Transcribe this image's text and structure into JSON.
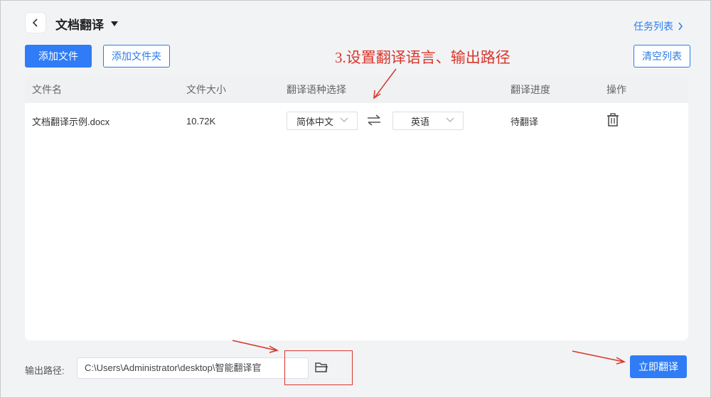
{
  "header": {
    "title": "文档翻译",
    "task_list_link": "任务列表"
  },
  "toolbar": {
    "add_file": "添加文件",
    "add_folder": "添加文件夹",
    "clear_list": "清空列表"
  },
  "annotation": {
    "step_text": "3.设置翻译语言、输出路径",
    "color": "#d9362b"
  },
  "table": {
    "columns": [
      "文件名",
      "文件大小",
      "翻译语种选择",
      "翻译进度",
      "操作"
    ],
    "rows": [
      {
        "name": "文档翻译示例.docx",
        "size": "10.72K",
        "source_lang": "简体中文",
        "target_lang": "英语",
        "progress": "待翻译"
      }
    ]
  },
  "footer": {
    "output_label": "输出路径:",
    "output_path": "C:\\Users\\Administrator\\desktop\\智能翻译官",
    "translate_button": "立即翻译"
  },
  "icons": [
    "back-icon",
    "dropdown-caret-icon",
    "chevron-right-icon",
    "chevron-down-icon",
    "swap-icon",
    "trash-icon",
    "folder-icon"
  ],
  "colors": {
    "accent": "#2f7cf6",
    "annotation_red": "#d9362b"
  }
}
